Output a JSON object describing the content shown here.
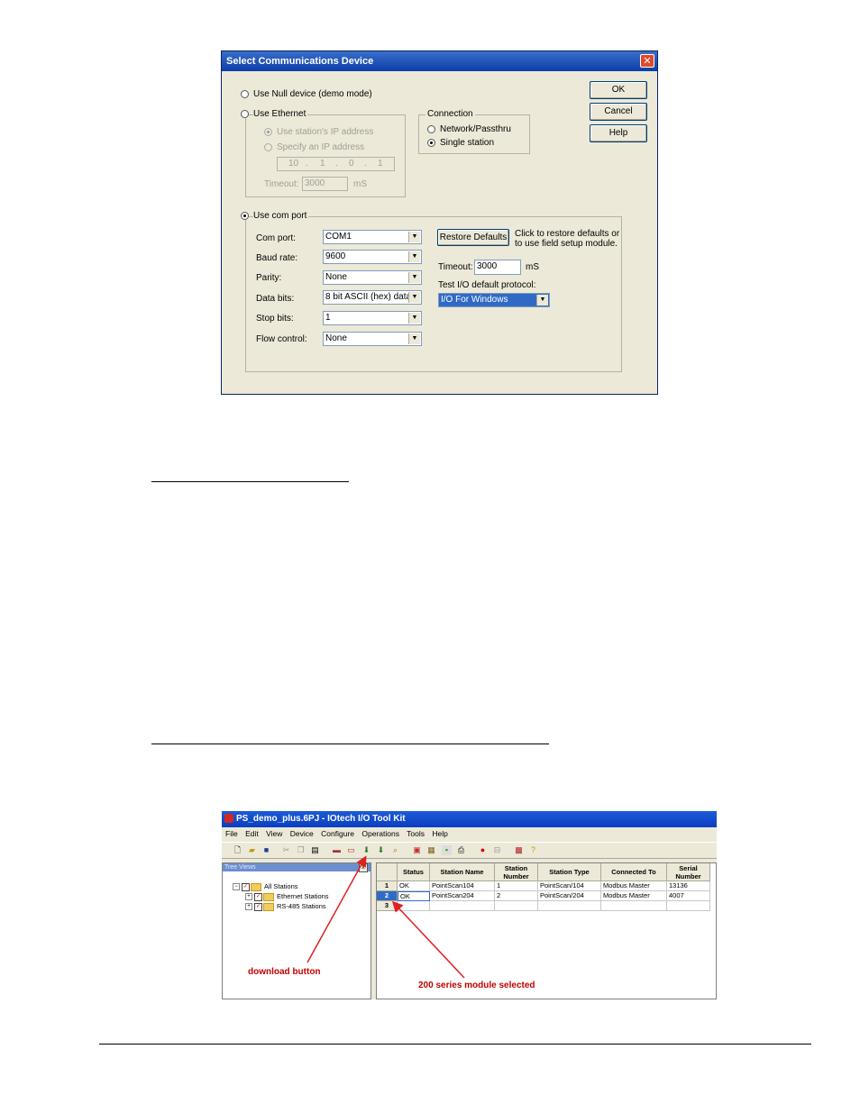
{
  "dialog": {
    "title": "Select Communications Device",
    "close_glyph": "✕",
    "ok": "OK",
    "cancel": "Cancel",
    "help": "Help",
    "null_device": "Use Null device (demo mode)",
    "use_ethernet": "Use Ethernet",
    "use_station_ip": "Use station's IP address",
    "specify_ip": "Specify an IP address",
    "ip": [
      "10",
      ".",
      "1",
      ".",
      "0",
      ".",
      "1"
    ],
    "timeout_label": "Timeout:",
    "eth_timeout": "3000",
    "eth_timeout_unit": "mS",
    "connection_label": "Connection",
    "network": "Network/Passthru",
    "single_station": "Single station",
    "use_com_port": "Use com port",
    "com_fields": [
      {
        "label": "Com port:",
        "value": "COM1"
      },
      {
        "label": "Baud rate:",
        "value": "9600"
      },
      {
        "label": "Parity:",
        "value": "None"
      },
      {
        "label": "Data bits:",
        "value": "8 bit ASCII (hex) data"
      },
      {
        "label": "Stop bits:",
        "value": "1"
      },
      {
        "label": "Flow control:",
        "value": "None"
      }
    ],
    "restore_defaults": "Restore Defaults",
    "restore_hint_1": "Click to restore defaults or",
    "restore_hint_2": "to use field setup module.",
    "com_timeout_label": "Timeout:",
    "com_timeout": "3000",
    "com_timeout_unit": "mS",
    "protocol_label": "Test I/O default protocol:",
    "protocol_value": "I/O For Windows",
    "selected_radio": "use_com_port",
    "selected_connection": "single_station"
  },
  "app": {
    "title": "PS_demo_plus.6PJ - IOtech I/O Tool Kit",
    "menu": [
      "File",
      "Edit",
      "View",
      "Device",
      "Configure",
      "Operations",
      "Tools",
      "Help"
    ],
    "tree_header": "Tree Views",
    "tree_close": "x",
    "tree": [
      {
        "label": "All Stations",
        "level": 0,
        "toggle": "−"
      },
      {
        "label": "Ethernet Stations",
        "level": 1,
        "toggle": "+"
      },
      {
        "label": "RS-485 Stations",
        "level": 1,
        "toggle": "+"
      }
    ],
    "check_glyph": "✓",
    "columns": [
      "Status",
      "Station Name",
      "Station Number",
      "Station Type",
      "Connected To",
      "Serial Number"
    ],
    "rows": [
      {
        "n": "1",
        "cells": [
          "OK",
          "PointScan104",
          "1",
          "PointScan/104",
          "Modbus Master",
          "13136"
        ]
      },
      {
        "n": "2",
        "cells": [
          "OK",
          "PointScan204",
          "2",
          "PointScan/204",
          "Modbus Master",
          "4007"
        ]
      },
      {
        "n": "3",
        "cells": [
          "",
          "",
          "",
          "",
          "",
          ""
        ]
      }
    ],
    "selected_row": 2,
    "callout_download": "download button",
    "callout_selected": "200 series module selected",
    "callout_color": "#c00000"
  }
}
